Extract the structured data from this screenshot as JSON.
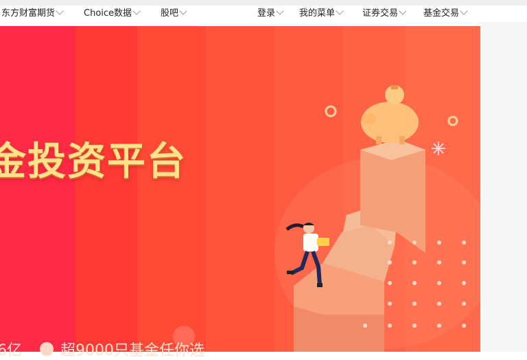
{
  "nav": {
    "left": [
      {
        "label": "东方财富期货"
      },
      {
        "label": "Choice数据"
      },
      {
        "label": "股吧"
      }
    ],
    "right": [
      {
        "label": "登录"
      },
      {
        "label": "我的菜单"
      },
      {
        "label": "证券交易"
      },
      {
        "label": "基金交易"
      }
    ]
  },
  "banner": {
    "headline": "金投资平台",
    "bottom_left": "6亿",
    "bottom_right": "超9000只基金任你选"
  },
  "colors": {
    "banner_red": "#ff2a45",
    "banner_orange": "#ff6a4a",
    "headline_gold": "#ffe28a"
  }
}
